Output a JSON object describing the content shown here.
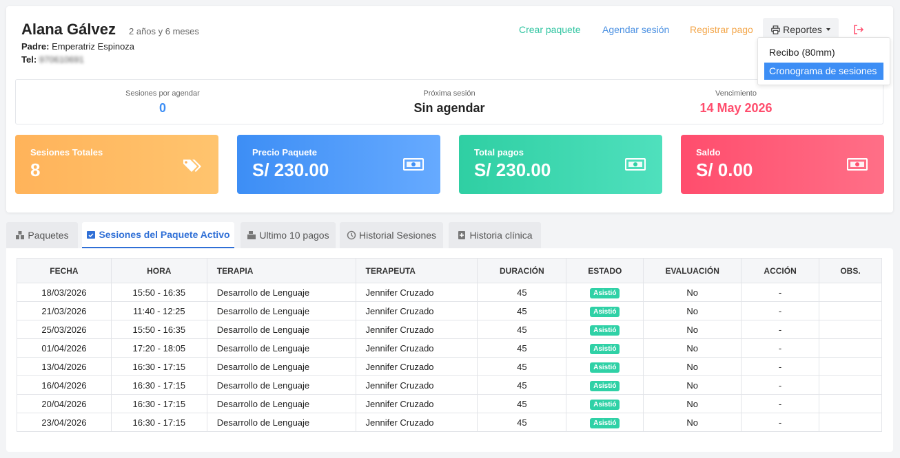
{
  "patient": {
    "name": "Alana Gálvez",
    "age": "2 años y 6 meses",
    "padre_label": "Padre:",
    "padre_value": "Emperatriz Espinoza",
    "tel_label": "Tel:",
    "tel_value": "970610691"
  },
  "actions": {
    "crear_paquete": "Crear paquete",
    "agendar_sesion": "Agendar sesión",
    "registrar_pago": "Registrar pago",
    "reportes": "Reportes"
  },
  "dropdown": {
    "items": [
      "Recibo (80mm)",
      "Cronograma de sesiones"
    ]
  },
  "summary": {
    "por_agendar_label": "Sesiones por agendar",
    "por_agendar_value": "0",
    "proxima_label": "Próxima sesión",
    "proxima_value": "Sin agendar",
    "vencimiento_label": "Vencimiento",
    "vencimiento_value": "14 May 2026"
  },
  "stats": {
    "sesiones_label": "Sesiones Totales",
    "sesiones_value": "8",
    "precio_label": "Precio Paquete",
    "precio_value": "S/ 230.00",
    "pagos_label": "Total pagos",
    "pagos_value": "S/ 230.00",
    "saldo_label": "Saldo",
    "saldo_value": "S/ 0.00"
  },
  "colors": {
    "accent_blue": "#3d8ef5",
    "green": "#2fcfa3",
    "orange": "#ffb35a",
    "red": "#ff4d6d"
  },
  "tabs": [
    "Paquetes",
    "Sesiones del Paquete Activo",
    "Ultimo 10 pagos",
    "Historial Sesiones",
    "Historia clínica"
  ],
  "table": {
    "headers": [
      "FECHA",
      "HORA",
      "TERAPIA",
      "TERAPEUTA",
      "DURACIÓN",
      "ESTADO",
      "EVALUACIÓN",
      "ACCIÓN",
      "OBS."
    ],
    "rows": [
      {
        "fecha": "18/03/2026",
        "hora": "15:50 - 16:35",
        "terapia": "Desarrollo de Lenguaje",
        "terapeuta": "Jennifer Cruzado",
        "duracion": "45",
        "estado": "Asistió",
        "evaluacion": "No",
        "accion": "-",
        "obs": ""
      },
      {
        "fecha": "21/03/2026",
        "hora": "11:40 - 12:25",
        "terapia": "Desarrollo de Lenguaje",
        "terapeuta": "Jennifer Cruzado",
        "duracion": "45",
        "estado": "Asistió",
        "evaluacion": "No",
        "accion": "-",
        "obs": ""
      },
      {
        "fecha": "25/03/2026",
        "hora": "15:50 - 16:35",
        "terapia": "Desarrollo de Lenguaje",
        "terapeuta": "Jennifer Cruzado",
        "duracion": "45",
        "estado": "Asistió",
        "evaluacion": "No",
        "accion": "-",
        "obs": ""
      },
      {
        "fecha": "01/04/2026",
        "hora": "17:20 - 18:05",
        "terapia": "Desarrollo de Lenguaje",
        "terapeuta": "Jennifer Cruzado",
        "duracion": "45",
        "estado": "Asistió",
        "evaluacion": "No",
        "accion": "-",
        "obs": ""
      },
      {
        "fecha": "13/04/2026",
        "hora": "16:30 - 17:15",
        "terapia": "Desarrollo de Lenguaje",
        "terapeuta": "Jennifer Cruzado",
        "duracion": "45",
        "estado": "Asistió",
        "evaluacion": "No",
        "accion": "-",
        "obs": ""
      },
      {
        "fecha": "16/04/2026",
        "hora": "16:30 - 17:15",
        "terapia": "Desarrollo de Lenguaje",
        "terapeuta": "Jennifer Cruzado",
        "duracion": "45",
        "estado": "Asistió",
        "evaluacion": "No",
        "accion": "-",
        "obs": ""
      },
      {
        "fecha": "20/04/2026",
        "hora": "16:30 - 17:15",
        "terapia": "Desarrollo de Lenguaje",
        "terapeuta": "Jennifer Cruzado",
        "duracion": "45",
        "estado": "Asistió",
        "evaluacion": "No",
        "accion": "-",
        "obs": ""
      },
      {
        "fecha": "23/04/2026",
        "hora": "16:30 - 17:15",
        "terapia": "Desarrollo de Lenguaje",
        "terapeuta": "Jennifer Cruzado",
        "duracion": "45",
        "estado": "Asistió",
        "evaluacion": "No",
        "accion": "-",
        "obs": ""
      }
    ]
  }
}
